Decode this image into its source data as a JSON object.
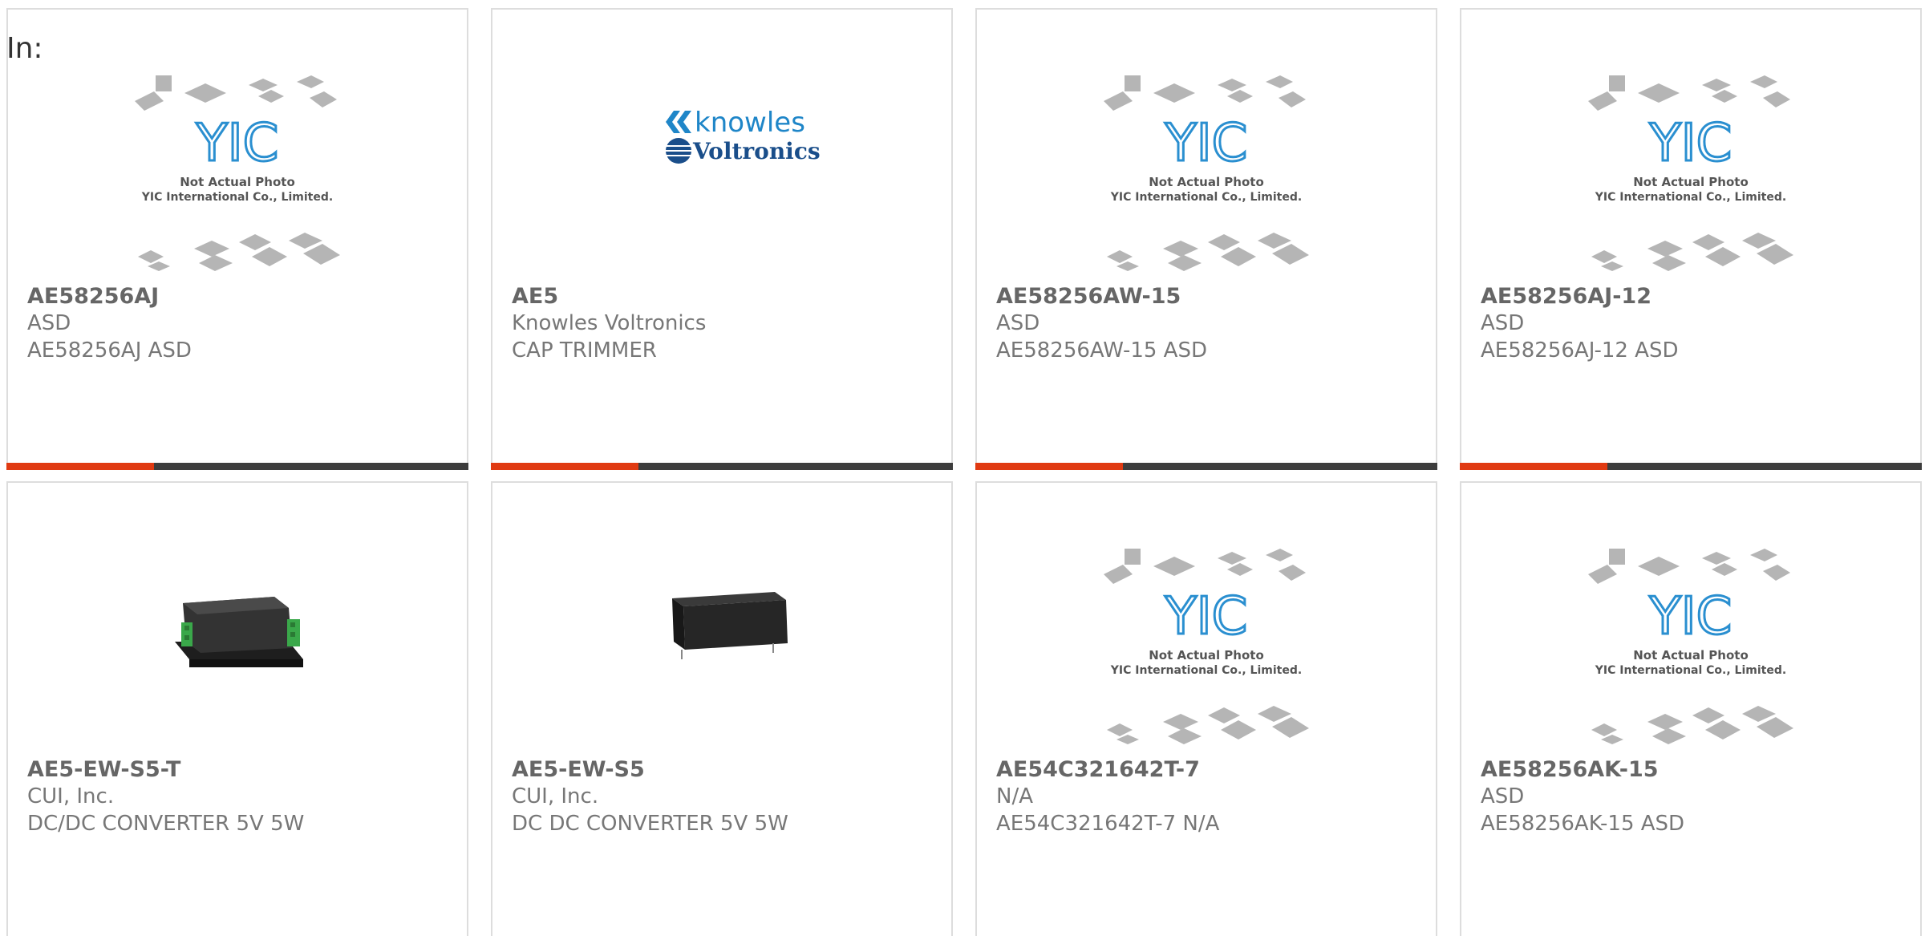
{
  "filter_label": "In:",
  "colors": {
    "accent": "#e03a12",
    "bar": "#3d3d3d",
    "card_border": "#dddddd",
    "title_text": "#666666",
    "body_text": "#777777",
    "yic_blue": "#2a8fd0",
    "knowles_blue": "#1f86c8",
    "voltronics_navy": "#1a4e8a"
  },
  "placeholder_photo": {
    "line1": "Not Actual Photo",
    "line2": "YIC International Co., Limited.",
    "logo_text": "YIC"
  },
  "knowles_logo": {
    "line1": "knowles",
    "line2": "Voltronics"
  },
  "products": [
    {
      "part_number": "AE58256AJ",
      "manufacturer": "ASD",
      "description": "AE58256AJ ASD",
      "image": "yic-placeholder"
    },
    {
      "part_number": "AE5",
      "manufacturer": "Knowles Voltronics",
      "description": "CAP TRIMMER",
      "image": "knowles-voltronics-logo"
    },
    {
      "part_number": "AE58256AW-15",
      "manufacturer": "ASD",
      "description": "AE58256AW-15 ASD",
      "image": "yic-placeholder"
    },
    {
      "part_number": "AE58256AJ-12",
      "manufacturer": "ASD",
      "description": "AE58256AJ-12 ASD",
      "image": "yic-placeholder"
    },
    {
      "part_number": "AE5-EW-S5-T",
      "manufacturer": "CUI, Inc.",
      "description": "DC/DC CONVERTER 5V 5W",
      "image": "converter-module-terminal-blocks"
    },
    {
      "part_number": "AE5-EW-S5",
      "manufacturer": "CUI, Inc.",
      "description": "DC DC CONVERTER 5V 5W",
      "image": "converter-module-black"
    },
    {
      "part_number": "AE54C321642T-7",
      "manufacturer": "N/A",
      "description": "AE54C321642T-7 N/A",
      "image": "yic-placeholder"
    },
    {
      "part_number": "AE58256AK-15",
      "manufacturer": "ASD",
      "description": "AE58256AK-15 ASD",
      "image": "yic-placeholder"
    }
  ]
}
